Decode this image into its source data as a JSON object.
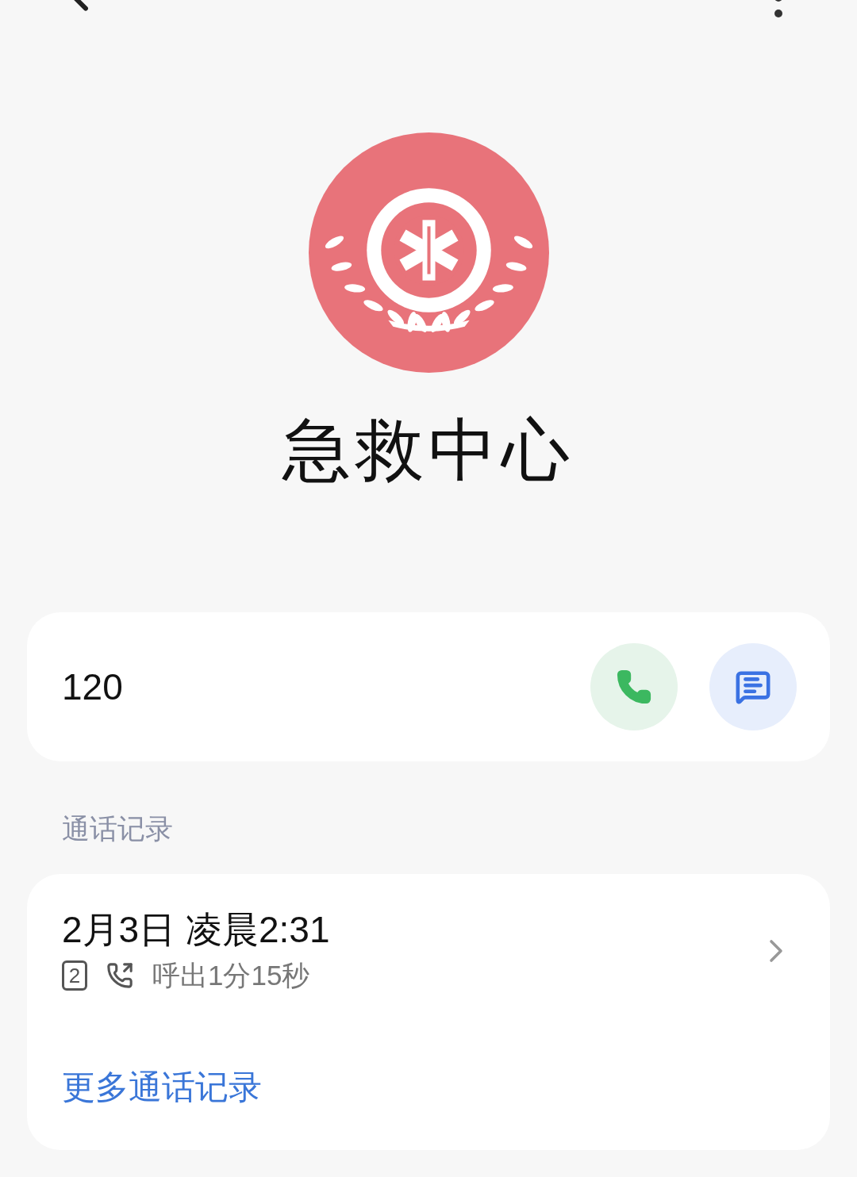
{
  "contact": {
    "name": "急救中心"
  },
  "number_card": {
    "number": "120"
  },
  "call_log": {
    "section_title": "通话记录",
    "entries": [
      {
        "date": "2月3日 凌晨2:31",
        "sim": "2",
        "kind": "outgoing",
        "detail": "呼出1分15秒"
      }
    ],
    "more_link": "更多通话记录"
  }
}
